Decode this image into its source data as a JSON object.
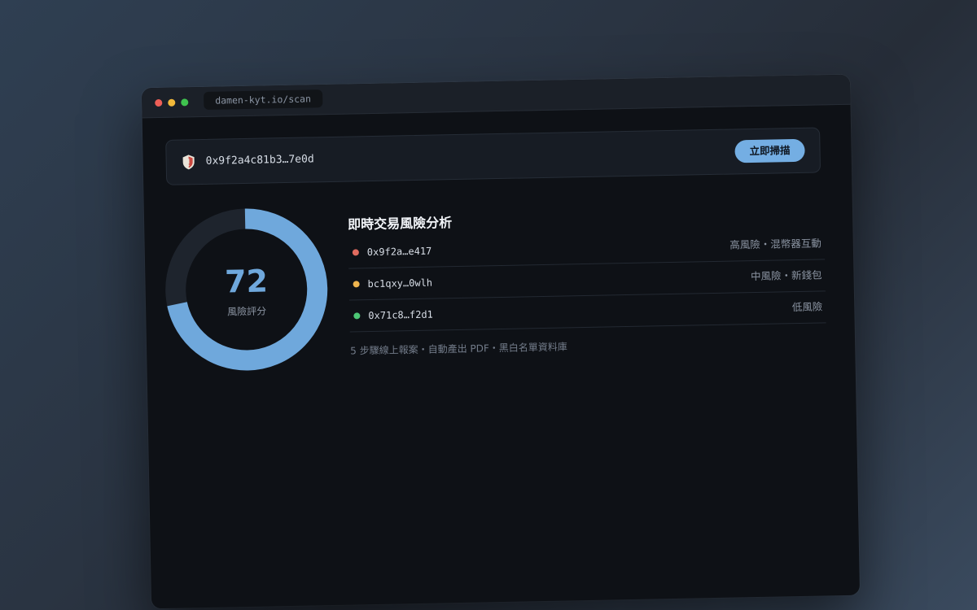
{
  "browser": {
    "url": "damen-kyt.io/scan"
  },
  "search": {
    "address": "0x9f2a4c81b3…7e0d",
    "scan_button": "立即掃描"
  },
  "gauge": {
    "score": "72",
    "score_value": 72,
    "score_max": 100,
    "label": "風險評分",
    "fill_color": "#6fa8dc",
    "track_color": "#1e242d"
  },
  "analysis": {
    "title": "即時交易風險分析",
    "rows": [
      {
        "address": "0x9f2a…e417",
        "tag": "高風險・混幣器互動",
        "color": "#e06b5f"
      },
      {
        "address": "bc1qxy…0wlh",
        "tag": "中風險・新錢包",
        "color": "#efb54e"
      },
      {
        "address": "0x71c8…f2d1",
        "tag": "低風險",
        "color": "#4cc775"
      }
    ],
    "footnote": "5 步驟線上報案・自動產出 PDF・黑白名單資料庫"
  },
  "icons": {
    "shield": "shield-icon"
  }
}
